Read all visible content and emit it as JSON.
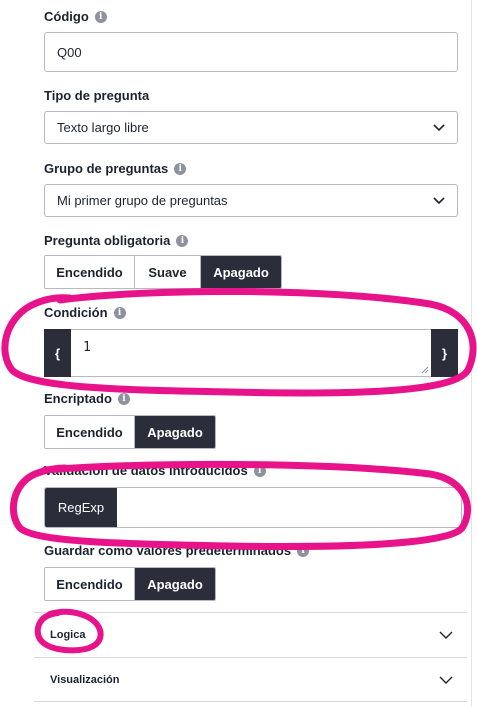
{
  "fields": {
    "codigo": {
      "label": "Código",
      "value": "Q00"
    },
    "tipo": {
      "label": "Tipo de pregunta",
      "value": "Texto largo libre"
    },
    "grupo": {
      "label": "Grupo de preguntas",
      "value": "Mi primer grupo de preguntas"
    },
    "obligatoria": {
      "label": "Pregunta obligatoria",
      "options": [
        "Encendido",
        "Suave",
        "Apagado"
      ],
      "selected": "Apagado"
    },
    "condicion": {
      "label": "Condición",
      "open_brace": "{",
      "value": "1",
      "close_brace": "}"
    },
    "encriptado": {
      "label": "Encriptado",
      "options": [
        "Encendido",
        "Apagado"
      ],
      "selected": "Apagado"
    },
    "validacion": {
      "label": "Validación de datos introducidos",
      "tag": "RegExp",
      "value": ""
    },
    "predeterminados": {
      "label": "Guardar como valores predeterminados",
      "options": [
        "Encendido",
        "Apagado"
      ],
      "selected": "Apagado"
    }
  },
  "sections": [
    {
      "label": "Logica"
    },
    {
      "label": "Visualización"
    }
  ],
  "colors": {
    "active_button": "#2b2e3a",
    "annotation": "#e8138a",
    "border": "#b6b9c2"
  },
  "icons": {
    "info": "info-icon",
    "chevron": "chevron-down-icon"
  }
}
